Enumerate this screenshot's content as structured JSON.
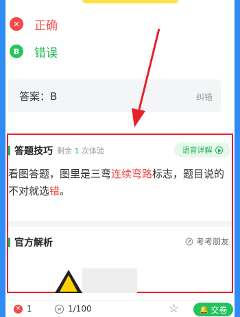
{
  "options": [
    {
      "letter": "✕",
      "text": "正确"
    },
    {
      "letter": "B",
      "text": "错误"
    }
  ],
  "answer": {
    "text": "答案：B",
    "report_label": "纠错"
  },
  "tips": {
    "title": "答题技巧",
    "remaining_prefix": "剩余",
    "remaining_count": "1",
    "remaining_suffix": "次体验",
    "voice_button": "语音详解",
    "text_part1": "看图答题，图里是三弯",
    "text_highlight1": "连续弯路",
    "text_part2": "标志，题目说的不对就选",
    "text_highlight2": "错",
    "text_part3": "。"
  },
  "official": {
    "title": "官方解析",
    "ask_friend": "考考朋友"
  },
  "bottom": {
    "wrong_count": "1",
    "progress": "1/100",
    "submit_label": "交卷"
  },
  "colors": {
    "accent_green": "#23c25c",
    "error_red": "#f04a4a",
    "highlight_box": "#e8202a"
  }
}
